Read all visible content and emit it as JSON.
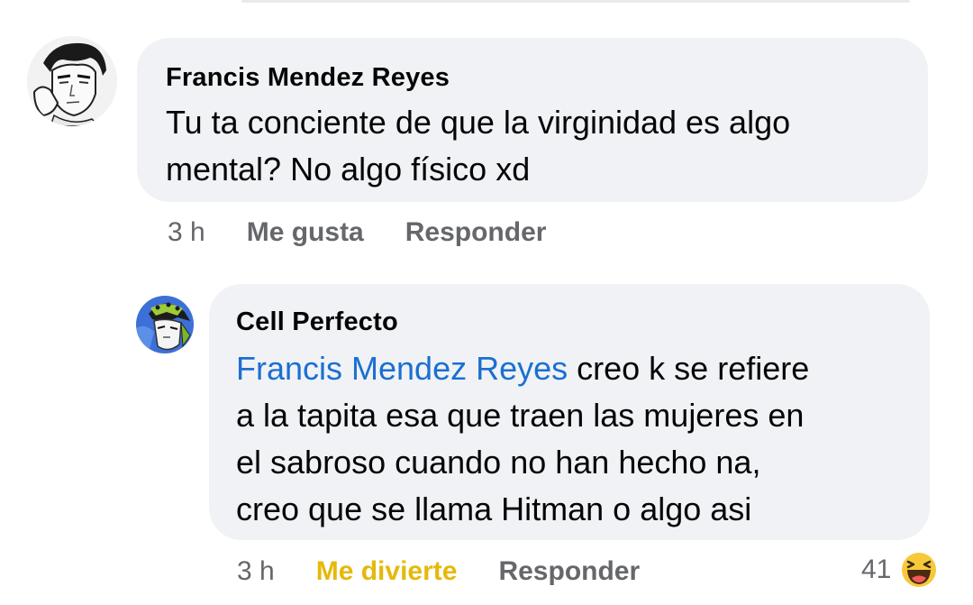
{
  "comments": [
    {
      "author": "Francis Mendez Reyes",
      "text_line1": "Tu ta conciente de que la virginidad es algo",
      "text_line2": "mental? No algo físico xd",
      "time": "3 h",
      "like_label": "Me gusta",
      "reply_label": "Responder",
      "avatar_icon": "anime-character-avatar-icon"
    },
    {
      "author": "Cell Perfecto",
      "mention": "Francis Mendez Reyes",
      "text_line1_rest": " creo k se refiere",
      "text_line2": "a la tapita esa que traen las mujeres en",
      "text_line3": "el sabroso cuando no han hecho na,",
      "text_line4": "creo que se llama Hitman o algo asi",
      "time": "3 h",
      "reaction_label": "Me divierte",
      "reply_label": "Responder",
      "reaction_count": "41",
      "reaction_icon": "haha-emoji-icon",
      "avatar_icon": "cell-character-avatar-icon"
    }
  ],
  "colors": {
    "bubble": "#f0f2f5",
    "mention": "#1b6fd1",
    "meta": "#65676b",
    "haha_active": "#e5b90a"
  }
}
